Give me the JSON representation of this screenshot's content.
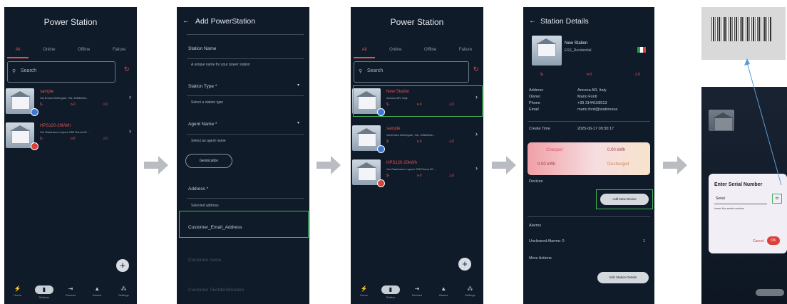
{
  "screen1": {
    "title": "Power Station",
    "tabs": [
      "All",
      "Online",
      "Offline",
      "Failure"
    ],
    "search_placeholder": "Search",
    "items": [
      {
        "name": "sample",
        "address": "Via Enrico Berlinguer, Via, 4058400c...",
        "stats": [
          "$-",
          "⊳0",
          "⚠0"
        ]
      },
      {
        "name": "HPS120-20kWh",
        "address": "Via Gianfranco Lepore 25B Roma 00...",
        "stats": [
          "$-",
          "⊳0",
          "⚠0"
        ]
      }
    ],
    "fab": "+",
    "nav": [
      {
        "icon": "⚡",
        "label": "Home"
      },
      {
        "icon": "▮",
        "label": "Stations"
      },
      {
        "icon": "⇥",
        "label": "Devices"
      },
      {
        "icon": "▲",
        "label": "Alarms"
      },
      {
        "icon": "⁂",
        "label": "Settings"
      }
    ]
  },
  "screen2": {
    "back": "←",
    "title": "Add PowerStation",
    "station_name_label": "Station Name",
    "station_name_hint": "A unique name for your power station",
    "station_type_label": "Station Type *",
    "station_type_hint": "Select a station type",
    "agent_name_label": "Agent Name *",
    "agent_name_hint": "Select an agent name",
    "geolocate_button": "Geolocalize",
    "address_label": "Address *",
    "address_hint": "Selected address",
    "customer_email_label": "Customer_Email_Address",
    "customer_name_label": "Customer name",
    "customer_id_label": "Customer Tax/Identification"
  },
  "screen3": {
    "title": "Power Station",
    "tabs": [
      "All",
      "Online",
      "Offline",
      "Failure"
    ],
    "search_placeholder": "Search",
    "items": [
      {
        "name": "New Station",
        "address": "Ancona AR, Italy",
        "stats": [
          "$-",
          "⊳0",
          "⚠0"
        ]
      },
      {
        "name": "sample",
        "address": "Via Enrico Berlinguer, Via, 4058400c...",
        "stats": [
          "$-",
          "⊳0",
          "⚠0"
        ]
      },
      {
        "name": "HPS120-20kWh",
        "address": "Via Gianfranco Lepore 25B Roma 00...",
        "stats": [
          "$-",
          "⊳0",
          "⚠0"
        ]
      }
    ],
    "fab": "+",
    "nav": [
      {
        "icon": "⚡",
        "label": "Home"
      },
      {
        "icon": "▮",
        "label": "Station"
      },
      {
        "icon": "⇥",
        "label": "Devices"
      },
      {
        "icon": "▲",
        "label": "Alarms"
      },
      {
        "icon": "⁂",
        "label": "Settings"
      }
    ]
  },
  "screen4": {
    "back": "←",
    "title": "Station Details",
    "station_name": "New Station",
    "station_type": "ESS_Residential",
    "stats": [
      "$-",
      "⊳0",
      "⚠0"
    ],
    "details": [
      {
        "label": "Address",
        "value": "Ancona AR, Italy"
      },
      {
        "label": "Owner",
        "value": "Mario Fonti"
      },
      {
        "label": "Phone",
        "value": "+39 3144158513"
      },
      {
        "label": "Email",
        "value": "mario.fonti@stationesa"
      }
    ],
    "create_time_label": "Create Time",
    "create_time_value": "2025-06-17 09:30:17",
    "charged_label": "Charged",
    "charged_value": "0.00 kWh",
    "discharged_label": "Discharged",
    "discharged_value": "0.00 kWh",
    "devices_label": "Devices",
    "add_device_button": "Add New Device",
    "alarms_label": "Alarms",
    "alarms_row": "Uncleared Alarms: 0",
    "alarms_count": "1",
    "more_actions_label": "More Actions",
    "edit_button": "Edit Station Details"
  },
  "screen5": {
    "dialog_title": "Enter Serial Number",
    "dialog_input": "Serial",
    "dialog_hint": "Insert the serial number",
    "cancel": "Cancel",
    "ok": "OK"
  }
}
